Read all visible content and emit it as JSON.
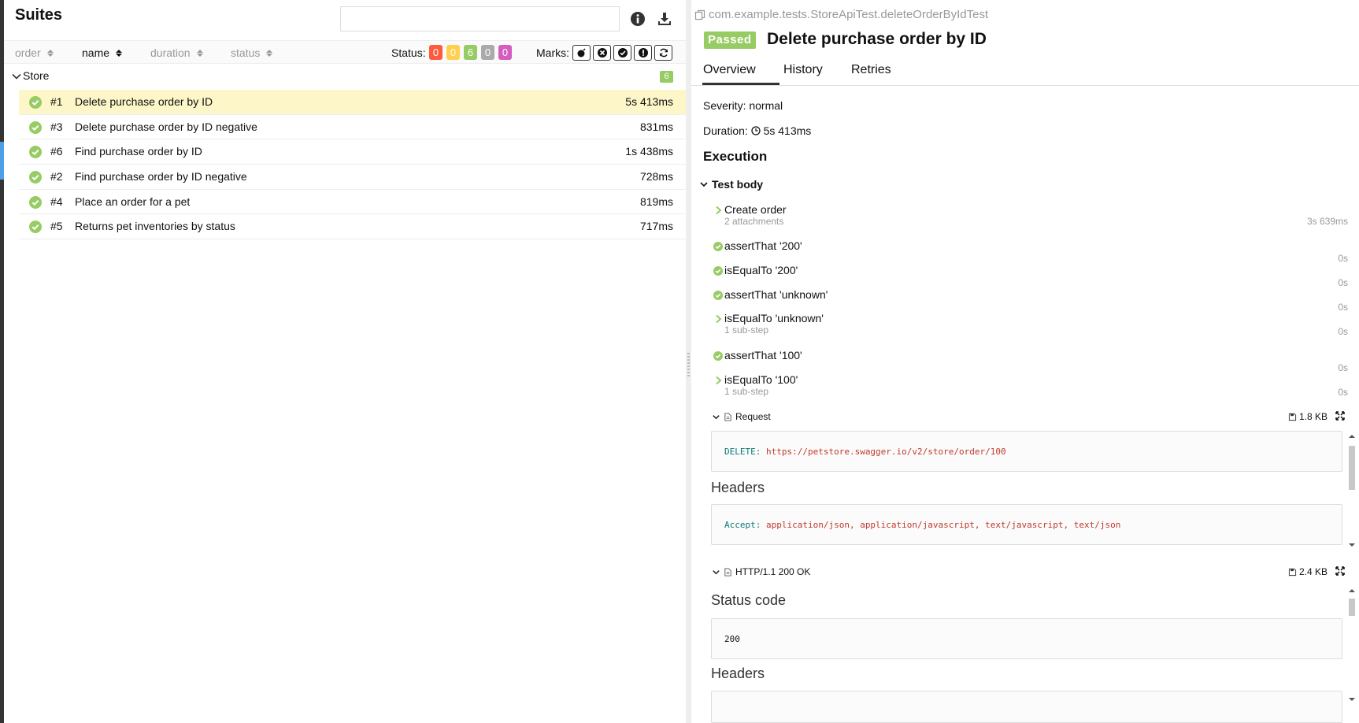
{
  "left": {
    "title": "Suites",
    "search": {
      "value": "",
      "placeholder": ""
    },
    "sort": [
      {
        "label": "order",
        "active": false
      },
      {
        "label": "name",
        "active": true
      },
      {
        "label": "duration",
        "active": false
      },
      {
        "label": "status",
        "active": false
      }
    ],
    "status_label": "Status:",
    "status_counts": [
      {
        "value": "0",
        "color": "#fd5a3e"
      },
      {
        "value": "0",
        "color": "#ffd050"
      },
      {
        "value": "6",
        "color": "#97cc64"
      },
      {
        "value": "0",
        "color": "#aaaaaa"
      },
      {
        "value": "0",
        "color": "#d35ebe"
      }
    ],
    "marks_label": "Marks:",
    "group": {
      "name": "Store",
      "count": "6"
    },
    "tests": [
      {
        "num": "#1",
        "name": "Delete purchase order by ID",
        "duration": "5s 413ms",
        "selected": true
      },
      {
        "num": "#3",
        "name": "Delete purchase order by ID negative",
        "duration": "831ms",
        "selected": false
      },
      {
        "num": "#6",
        "name": "Find purchase order by ID",
        "duration": "1s 438ms",
        "selected": false
      },
      {
        "num": "#2",
        "name": "Find purchase order by ID negative",
        "duration": "728ms",
        "selected": false
      },
      {
        "num": "#4",
        "name": "Place an order for a pet",
        "duration": "819ms",
        "selected": false
      },
      {
        "num": "#5",
        "name": "Returns pet inventories by status",
        "duration": "717ms",
        "selected": false
      }
    ]
  },
  "right": {
    "full_name": "com.example.tests.StoreApiTest.deleteOrderByIdTest",
    "status_badge": "Passed",
    "title": "Delete purchase order by ID",
    "tabs": [
      "Overview",
      "History",
      "Retries"
    ],
    "severity": "Severity: normal",
    "duration_label": "Duration:",
    "duration": "5s 413ms",
    "execution_heading": "Execution",
    "test_body_heading": "Test body",
    "steps": [
      {
        "name": "Create order",
        "sub": "2 attachments",
        "time": "3s 639ms",
        "kind": "expand"
      },
      {
        "name": "assertThat '200'",
        "sub": "",
        "time": "0s",
        "kind": "passed"
      },
      {
        "name": "isEqualTo '200'",
        "sub": "",
        "time": "0s",
        "kind": "passed"
      },
      {
        "name": "assertThat 'unknown'",
        "sub": "",
        "time": "0s",
        "kind": "passed"
      },
      {
        "name": "isEqualTo 'unknown'",
        "sub": "1 sub-step",
        "time": "0s",
        "kind": "expand"
      },
      {
        "name": "assertThat '100'",
        "sub": "",
        "time": "0s",
        "kind": "passed"
      },
      {
        "name": "isEqualTo '100'",
        "sub": "1 sub-step",
        "time": "0s",
        "kind": "expand"
      }
    ],
    "request": {
      "title": "Request",
      "size": "1.8 KB",
      "method_key": "DELETE:",
      "url": "https://petstore.swagger.io/v2/store/order/100",
      "headers_heading": "Headers",
      "header_key": "Accept:",
      "header_value": "application/json, application/javascript, text/javascript, text/json"
    },
    "response": {
      "title": "HTTP/1.1 200 OK",
      "size": "2.4 KB",
      "status_heading": "Status code",
      "status_code": "200",
      "headers_heading": "Headers"
    }
  },
  "colors": {
    "passed": "#97cc64",
    "selected_row": "#fcf6c8",
    "accent": "#4e9fe8"
  }
}
